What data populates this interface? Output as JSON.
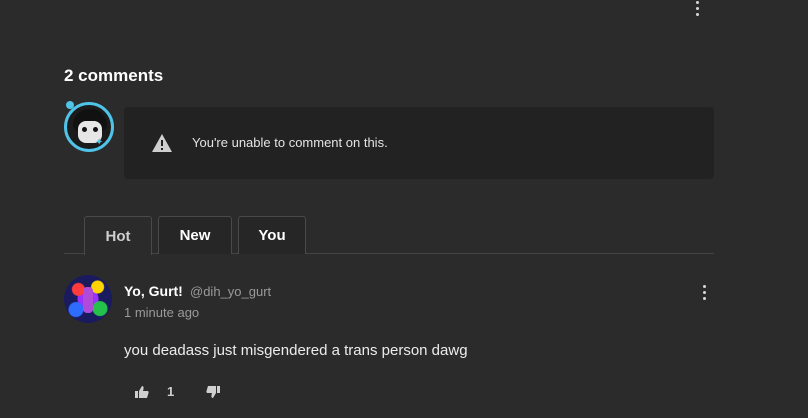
{
  "header": {
    "more_icon": "kebab-vertical-icon"
  },
  "comments_section": {
    "title": "2 comments",
    "notice": {
      "icon": "warning-triangle-icon",
      "text": "You're unable to comment on this."
    },
    "tabs": [
      {
        "label": "Hot",
        "active": true
      },
      {
        "label": "New",
        "active": false
      },
      {
        "label": "You",
        "active": false
      }
    ]
  },
  "comment": {
    "author": "Yo, Gurt!",
    "handle": "@dih_yo_gurt",
    "time": "1 minute ago",
    "body": "you deadass just misgendered a trans person dawg",
    "votes": "1",
    "up_icon": "thumbs-up-icon",
    "down_icon": "thumbs-down-icon"
  },
  "colors": {
    "background": "#2b2b2b",
    "notice_bg": "#222222",
    "avatar_ring": "#4fc3e8",
    "muted_text": "#9a9a9a"
  }
}
